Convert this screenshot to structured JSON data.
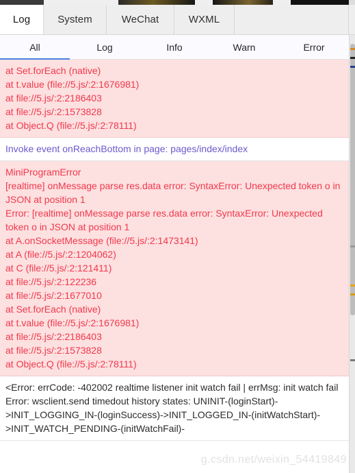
{
  "devtools": {
    "panel_tabs": [
      {
        "label": "Log",
        "name": "tab-log",
        "active": true
      },
      {
        "label": "System",
        "name": "tab-system",
        "active": false
      },
      {
        "label": "WeChat",
        "name": "tab-wechat",
        "active": false
      },
      {
        "label": "WXML",
        "name": "tab-wxml",
        "active": false
      }
    ],
    "level_filters": [
      {
        "label": "All",
        "name": "filter-all",
        "active": true
      },
      {
        "label": "Log",
        "name": "filter-log",
        "active": false
      },
      {
        "label": "Info",
        "name": "filter-info",
        "active": false
      },
      {
        "label": "Warn",
        "name": "filter-warn",
        "active": false
      },
      {
        "label": "Error",
        "name": "filter-error",
        "active": false
      }
    ],
    "console_entries": [
      {
        "level": "error",
        "text": "at Set.forEach (native)\nat t.value (file://5.js/:2:1676981)\nat file://5.js/:2:2186403\nat file://5.js/:2:1573828\nat Object.Q (file://5.js/:2:78111)"
      },
      {
        "level": "info",
        "text": "Invoke event onReachBottom in page: pages/index/index"
      },
      {
        "level": "error",
        "text": "MiniProgramError\n[realtime] onMessage parse res.data error: SyntaxError: Unexpected token o in JSON at position 1\nError: [realtime] onMessage parse res.data error: SyntaxError: Unexpected token o in JSON at position 1\nat A.onSocketMessage (file://5.js/:2:1473141)\nat A (file://5.js/:2:1204062)\nat C (file://5.js/:2:121411)\nat file://5.js/:2:122236\nat file://5.js/:2:1677010\nat Set.forEach (native)\nat t.value (file://5.js/:2:1676981)\nat file://5.js/:2:2186403\nat file://5.js/:2:1573828\nat Object.Q (file://5.js/:2:78111)"
      },
      {
        "level": "plain",
        "text": "<Error: errCode: -402002 realtime listener init watch fail | errMsg: init watch fail Error: wsclient.send timedout history states: UNINIT-(loginStart)->INIT_LOGGING_IN-(loginSuccess)->INIT_LOGGED_IN-(initWatchStart)->INIT_WATCH_PENDING-(initWatchFail)-"
      }
    ],
    "scrollbar": {
      "thumb_top_pct": 2,
      "thumb_height_pct": 62,
      "markers": [
        {
          "top_pct": 3,
          "color": "#d08a2a"
        },
        {
          "top_pct": 5,
          "color": "#222222"
        },
        {
          "top_pct": 7,
          "color": "#26408b"
        },
        {
          "top_pct": 48,
          "color": "#9a9a9a"
        },
        {
          "top_pct": 57,
          "color": "#e8a317"
        },
        {
          "top_pct": 59,
          "color": "#d89b14"
        },
        {
          "top_pct": 74,
          "color": "#7a7a7a"
        }
      ]
    },
    "watermark": "g.csdn.net/weixin_54419849"
  }
}
